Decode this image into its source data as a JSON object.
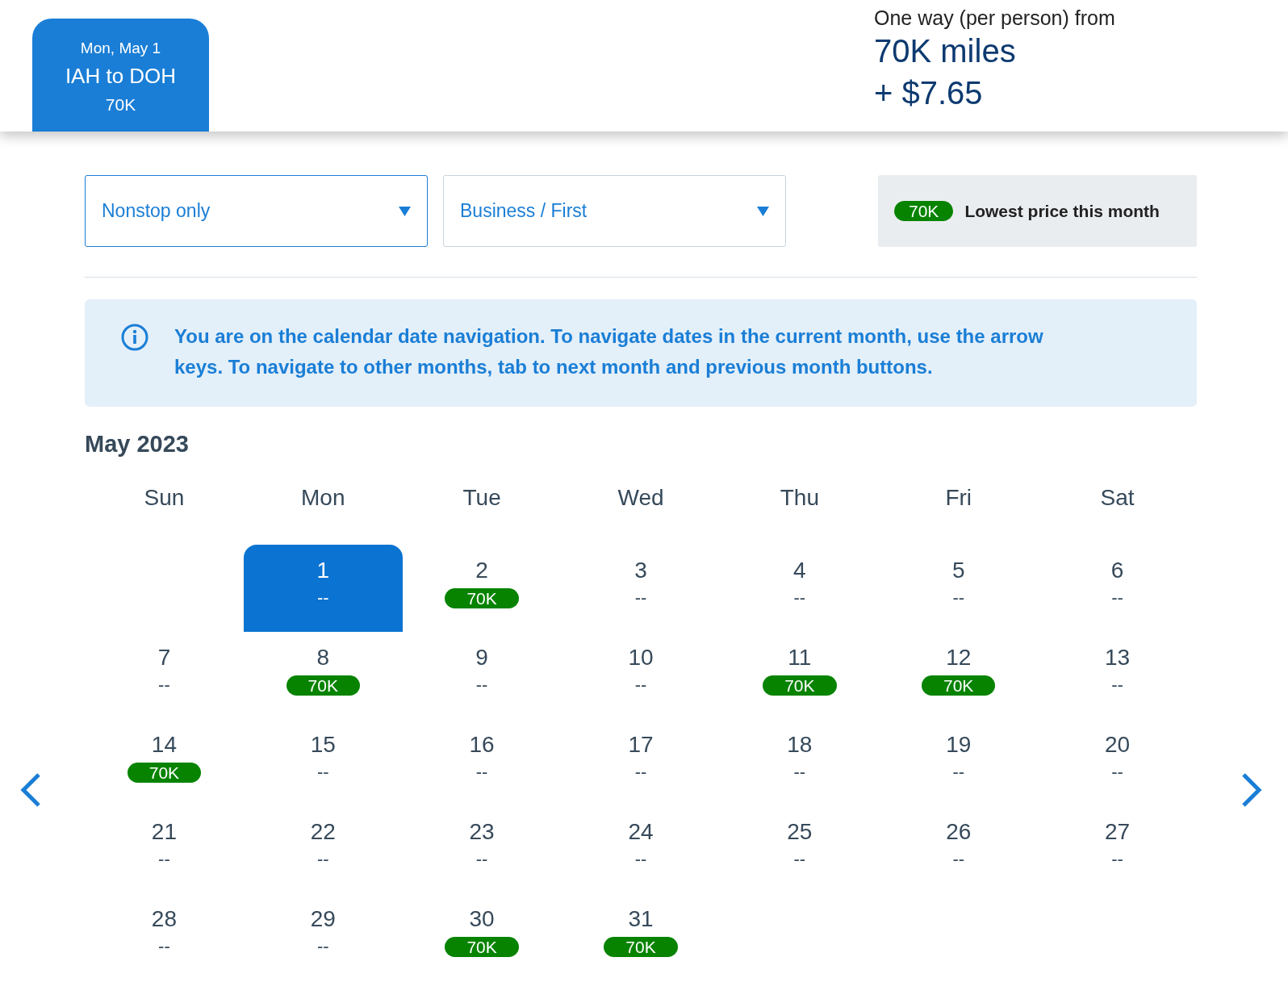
{
  "header": {
    "tab": {
      "date": "Mon, May 1",
      "route": "IAH to DOH",
      "price": "70K",
      "selected": true
    },
    "fare": {
      "label": "One way (per person) from",
      "miles": "70K miles",
      "cash": "+ $7.65"
    }
  },
  "filters": [
    {
      "value": "Nonstop only",
      "selected": true
    },
    {
      "value": "Business / First",
      "selected": false
    }
  ],
  "legend": {
    "badge": "70K",
    "text": "Lowest price this month"
  },
  "info": {
    "text": "You are on the calendar date navigation. To navigate dates in the current month, use the arrow keys. To navigate to other months, tab to next month and previous month buttons."
  },
  "calendar": {
    "month": "May 2023",
    "weekdays": [
      "Sun",
      "Mon",
      "Tue",
      "Wed",
      "Thu",
      "Fri",
      "Sat"
    ],
    "weeks": [
      {
        "kind": "first",
        "days": [
          {
            "day": "1",
            "price": "--",
            "lowest": false,
            "selected": true
          },
          {
            "day": "2",
            "price": "70K",
            "lowest": true,
            "selected": false
          },
          {
            "day": "3",
            "price": "--",
            "lowest": false,
            "selected": false
          },
          {
            "day": "4",
            "price": "--",
            "lowest": false,
            "selected": false
          },
          {
            "day": "5",
            "price": "--",
            "lowest": false,
            "selected": false
          },
          {
            "day": "6",
            "price": "--",
            "lowest": false,
            "selected": false
          }
        ]
      },
      {
        "kind": "full",
        "days": [
          {
            "day": "7",
            "price": "--",
            "lowest": false,
            "selected": false
          },
          {
            "day": "8",
            "price": "70K",
            "lowest": true,
            "selected": false
          },
          {
            "day": "9",
            "price": "--",
            "lowest": false,
            "selected": false
          },
          {
            "day": "10",
            "price": "--",
            "lowest": false,
            "selected": false
          },
          {
            "day": "11",
            "price": "70K",
            "lowest": true,
            "selected": false
          },
          {
            "day": "12",
            "price": "70K",
            "lowest": true,
            "selected": false
          },
          {
            "day": "13",
            "price": "--",
            "lowest": false,
            "selected": false
          }
        ]
      },
      {
        "kind": "full",
        "days": [
          {
            "day": "14",
            "price": "70K",
            "lowest": true,
            "selected": false
          },
          {
            "day": "15",
            "price": "--",
            "lowest": false,
            "selected": false
          },
          {
            "day": "16",
            "price": "--",
            "lowest": false,
            "selected": false
          },
          {
            "day": "17",
            "price": "--",
            "lowest": false,
            "selected": false
          },
          {
            "day": "18",
            "price": "--",
            "lowest": false,
            "selected": false
          },
          {
            "day": "19",
            "price": "--",
            "lowest": false,
            "selected": false
          },
          {
            "day": "20",
            "price": "--",
            "lowest": false,
            "selected": false
          }
        ]
      },
      {
        "kind": "full",
        "days": [
          {
            "day": "21",
            "price": "--",
            "lowest": false,
            "selected": false
          },
          {
            "day": "22",
            "price": "--",
            "lowest": false,
            "selected": false
          },
          {
            "day": "23",
            "price": "--",
            "lowest": false,
            "selected": false
          },
          {
            "day": "24",
            "price": "--",
            "lowest": false,
            "selected": false
          },
          {
            "day": "25",
            "price": "--",
            "lowest": false,
            "selected": false
          },
          {
            "day": "26",
            "price": "--",
            "lowest": false,
            "selected": false
          },
          {
            "day": "27",
            "price": "--",
            "lowest": false,
            "selected": false
          }
        ]
      },
      {
        "kind": "last",
        "days": [
          {
            "day": "28",
            "price": "--",
            "lowest": false,
            "selected": false
          },
          {
            "day": "29",
            "price": "--",
            "lowest": false,
            "selected": false
          },
          {
            "day": "30",
            "price": "70K",
            "lowest": true,
            "selected": false
          },
          {
            "day": "31",
            "price": "70K",
            "lowest": true,
            "selected": false
          }
        ]
      }
    ]
  }
}
